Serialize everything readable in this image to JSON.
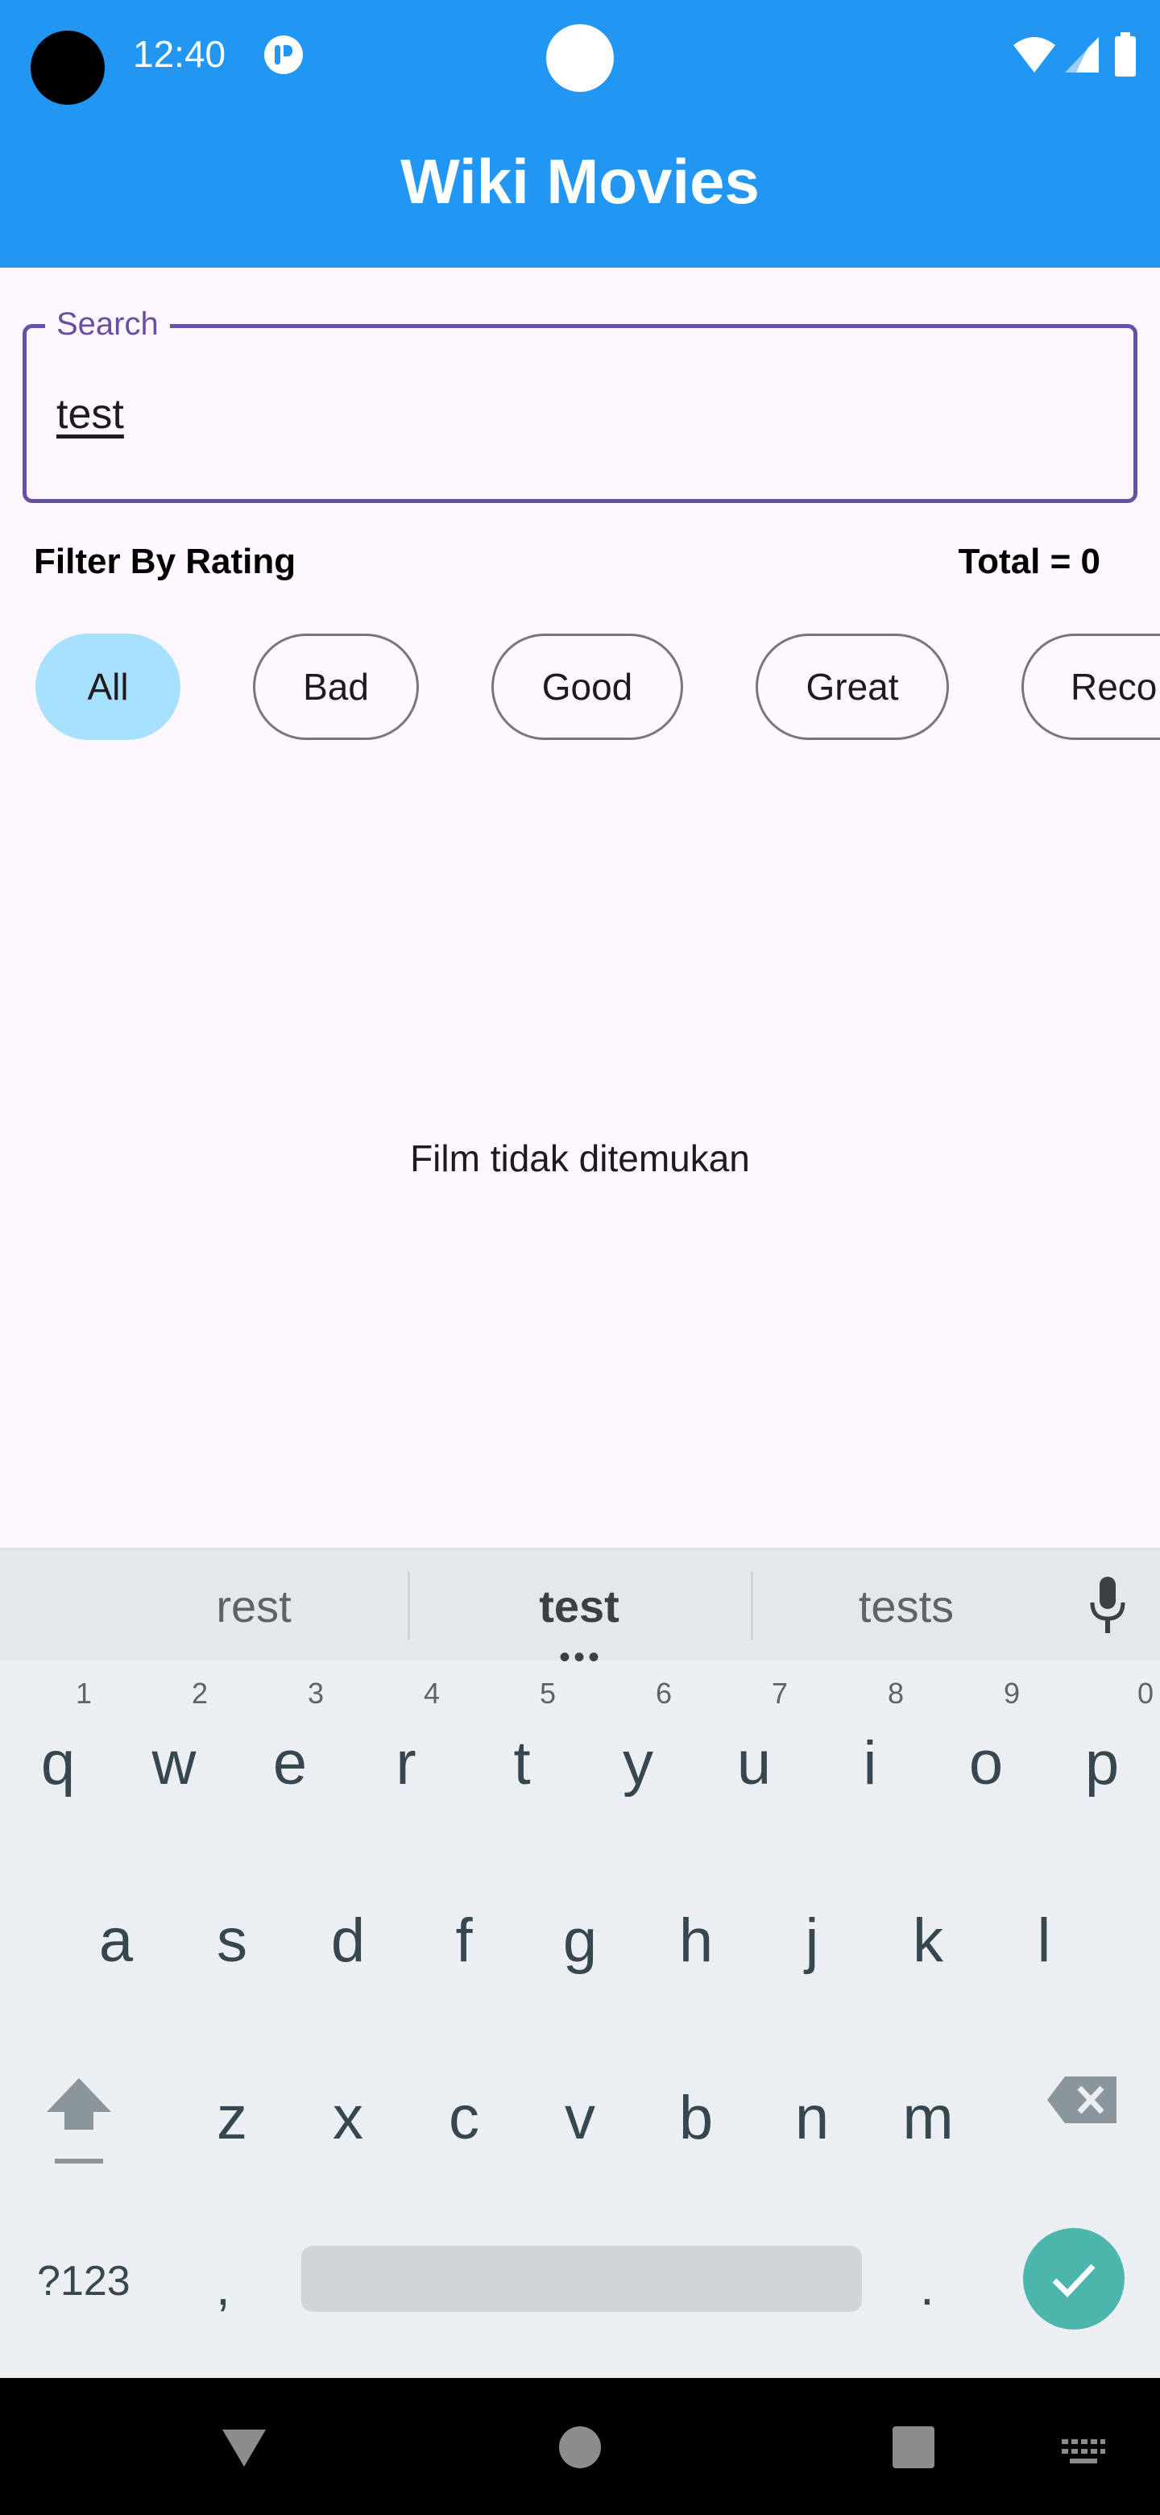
{
  "status_bar": {
    "time": "12:40"
  },
  "app_bar": {
    "title": "Wiki Movies"
  },
  "search": {
    "label": "Search",
    "value": "test"
  },
  "filter": {
    "label": "Filter By Rating",
    "total": "Total = 0",
    "chips": [
      {
        "label": "All",
        "selected": true
      },
      {
        "label": "Bad",
        "selected": false
      },
      {
        "label": "Good",
        "selected": false
      },
      {
        "label": "Great",
        "selected": false
      },
      {
        "label": "Reco",
        "selected": false
      }
    ]
  },
  "empty_state": {
    "message": "Film tidak ditemukan"
  },
  "keyboard": {
    "suggestions": [
      "rest",
      "test",
      "tests"
    ],
    "row1": [
      {
        "key": "q",
        "num": "1"
      },
      {
        "key": "w",
        "num": "2"
      },
      {
        "key": "e",
        "num": "3"
      },
      {
        "key": "r",
        "num": "4"
      },
      {
        "key": "t",
        "num": "5"
      },
      {
        "key": "y",
        "num": "6"
      },
      {
        "key": "u",
        "num": "7"
      },
      {
        "key": "i",
        "num": "8"
      },
      {
        "key": "o",
        "num": "9"
      },
      {
        "key": "p",
        "num": "0"
      }
    ],
    "row2": [
      "a",
      "s",
      "d",
      "f",
      "g",
      "h",
      "j",
      "k",
      "l"
    ],
    "row3": [
      "z",
      "x",
      "c",
      "v",
      "b",
      "n",
      "m"
    ],
    "symbols_label": "?123",
    "comma": ",",
    "period": "."
  },
  "colors": {
    "app_bar": "#2196f3",
    "accent": "#6750a4",
    "chip_selected": "#a8e0ff",
    "enter_key": "#4db6ac"
  }
}
